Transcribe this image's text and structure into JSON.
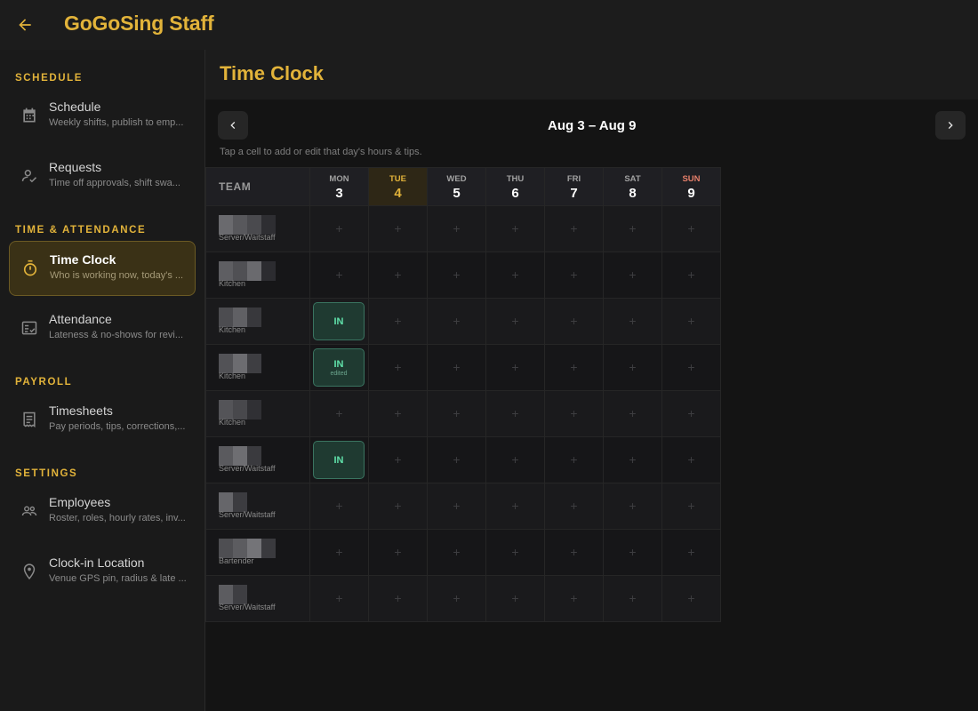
{
  "app": {
    "title": "GoGoSing Staff",
    "back_icon": "arrow-left-icon"
  },
  "colors": {
    "accent": "#e2b33a",
    "active_bg": "#3a3116",
    "clock_in": "#5fe0a9",
    "sunday": "#e57f6a"
  },
  "sidebar": {
    "sections": [
      {
        "title": "SCHEDULE",
        "items": [
          {
            "label": "Schedule",
            "sub": "Weekly shifts, publish to emp...",
            "icon": "calendar-icon",
            "active": false
          },
          {
            "label": "Requests",
            "sub": "Time off approvals, shift swa...",
            "icon": "person-check-icon",
            "active": false
          }
        ]
      },
      {
        "title": "TIME & ATTENDANCE",
        "items": [
          {
            "label": "Time Clock",
            "sub": "Who is working now, today's ...",
            "icon": "timer-icon",
            "active": true
          },
          {
            "label": "Attendance",
            "sub": "Lateness & no-shows for revi...",
            "icon": "fact-check-icon",
            "active": false
          }
        ]
      },
      {
        "title": "PAYROLL",
        "items": [
          {
            "label": "Timesheets",
            "sub": "Pay periods, tips, corrections,...",
            "icon": "receipt-icon",
            "active": false
          }
        ]
      },
      {
        "title": "SETTINGS",
        "items": [
          {
            "label": "Employees",
            "sub": "Roster, roles, hourly rates, inv...",
            "icon": "people-icon",
            "active": false
          },
          {
            "label": "Clock-in Location",
            "sub": "Venue GPS pin, radius & late ...",
            "icon": "location-pin-icon",
            "active": false
          }
        ]
      }
    ]
  },
  "page": {
    "title": "Time Clock",
    "week_range": "Aug 3 – Aug 9",
    "hint": "Tap a cell to add or edit that day's hours & tips.",
    "prev_icon": "chevron-left-icon",
    "next_icon": "chevron-right-icon"
  },
  "grid": {
    "team_header": "TEAM",
    "empty_symbol": "+",
    "days": [
      {
        "dow": "MON",
        "num": "3",
        "today": false,
        "sunday": false
      },
      {
        "dow": "TUE",
        "num": "4",
        "today": true,
        "sunday": false
      },
      {
        "dow": "WED",
        "num": "5",
        "today": false,
        "sunday": false
      },
      {
        "dow": "THU",
        "num": "6",
        "today": false,
        "sunday": false
      },
      {
        "dow": "FRI",
        "num": "7",
        "today": false,
        "sunday": false
      },
      {
        "dow": "SAT",
        "num": "8",
        "today": false,
        "sunday": false
      },
      {
        "dow": "SUN",
        "num": "9",
        "today": false,
        "sunday": true
      }
    ],
    "employees": [
      {
        "role": "Server/Waitstaff",
        "cells": [
          null,
          null,
          null,
          null,
          null,
          null,
          null
        ]
      },
      {
        "role": "Kitchen",
        "cells": [
          null,
          null,
          null,
          null,
          null,
          null,
          null
        ]
      },
      {
        "role": "Kitchen",
        "cells": [
          {
            "status": "IN",
            "note": ""
          },
          null,
          null,
          null,
          null,
          null,
          null
        ]
      },
      {
        "role": "Kitchen",
        "cells": [
          {
            "status": "IN",
            "note": "edited"
          },
          null,
          null,
          null,
          null,
          null,
          null
        ]
      },
      {
        "role": "Kitchen",
        "cells": [
          null,
          null,
          null,
          null,
          null,
          null,
          null
        ]
      },
      {
        "role": "Server/Waitstaff",
        "cells": [
          {
            "status": "IN",
            "note": ""
          },
          null,
          null,
          null,
          null,
          null,
          null
        ]
      },
      {
        "role": "Server/Waitstaff",
        "cells": [
          null,
          null,
          null,
          null,
          null,
          null,
          null
        ]
      },
      {
        "role": "Bartender",
        "cells": [
          null,
          null,
          null,
          null,
          null,
          null,
          null
        ]
      },
      {
        "role": "Server/Waitstaff",
        "cells": [
          null,
          null,
          null,
          null,
          null,
          null,
          null
        ]
      }
    ]
  }
}
